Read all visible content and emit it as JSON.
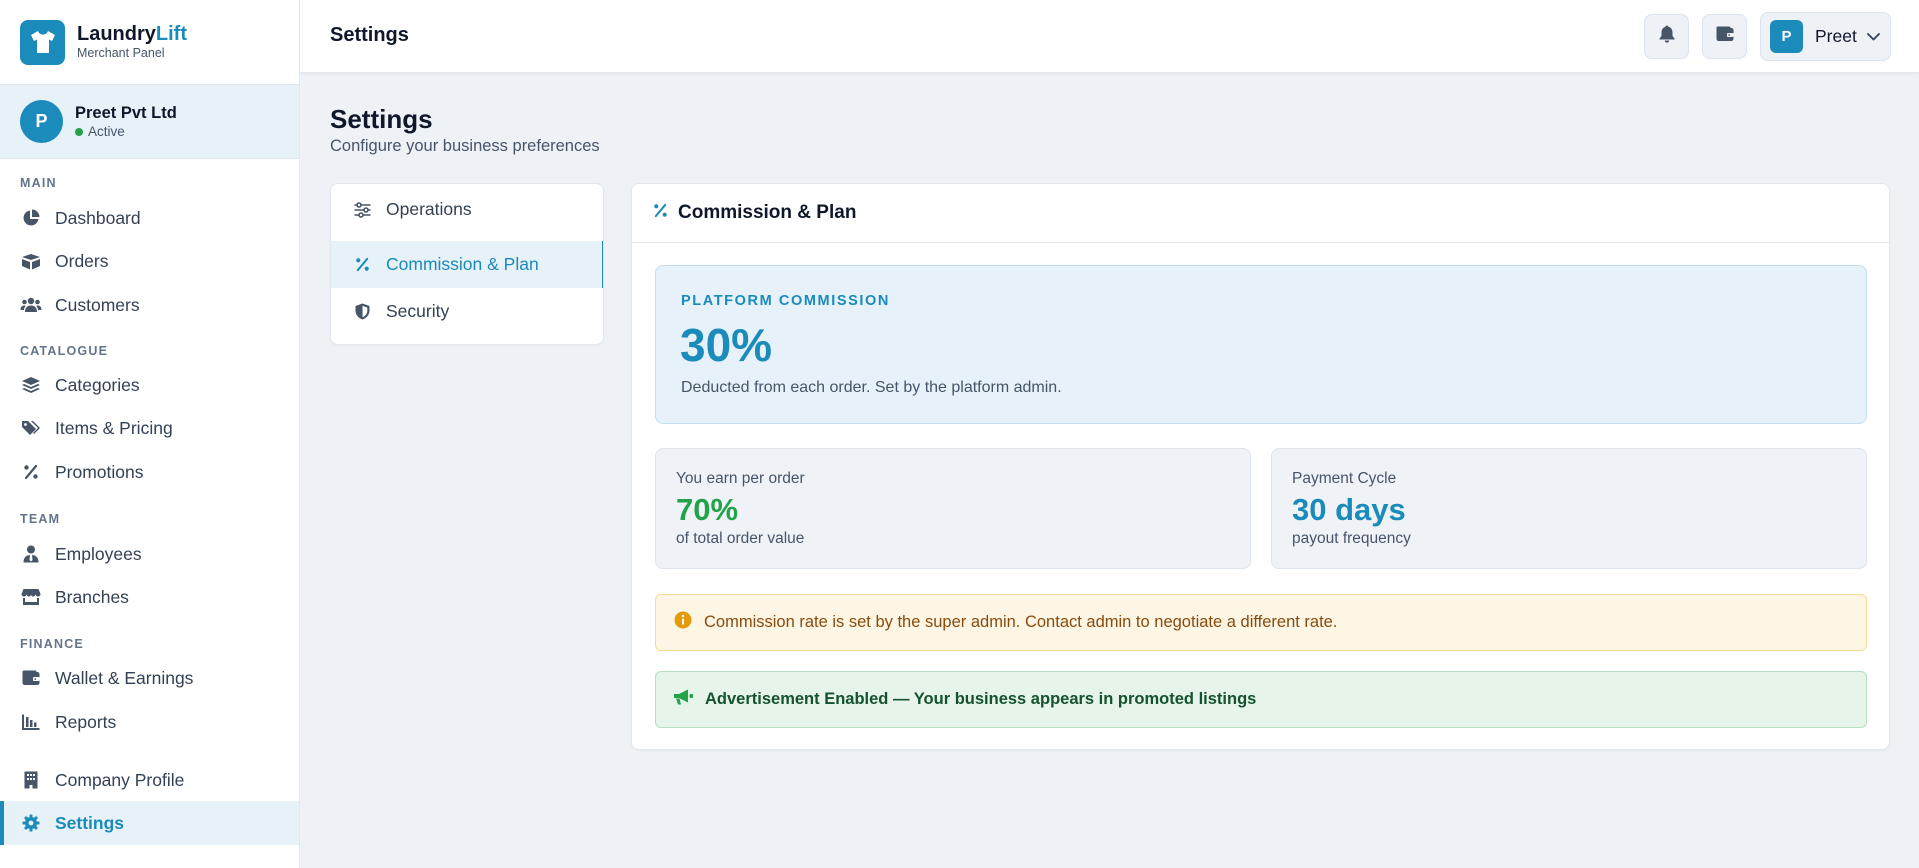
{
  "brand": {
    "name_part1": "Laundry",
    "name_part2": "Lift",
    "subtitle": "Merchant Panel"
  },
  "company": {
    "avatar_initial": "P",
    "name": "Preet Pvt Ltd",
    "status": "Active"
  },
  "sidebar": {
    "sections": {
      "main": "MAIN",
      "catalogue": "CATALOGUE",
      "team": "TEAM",
      "finance": "FINANCE"
    },
    "items": {
      "dashboard": "Dashboard",
      "orders": "Orders",
      "customers": "Customers",
      "categories": "Categories",
      "items_pricing": "Items & Pricing",
      "promotions": "Promotions",
      "employees": "Employees",
      "branches": "Branches",
      "wallet": "Wallet & Earnings",
      "reports": "Reports",
      "company_profile": "Company Profile",
      "settings": "Settings"
    },
    "active": "settings"
  },
  "topbar": {
    "title": "Settings",
    "user_initial": "P",
    "user_name": "Preet"
  },
  "page": {
    "title": "Settings",
    "subtitle": "Configure your business preferences"
  },
  "tabs": {
    "operations": "Operations",
    "commission": "Commission & Plan",
    "security": "Security",
    "active": "commission"
  },
  "panel": {
    "title": "Commission & Plan",
    "commission": {
      "label": "PLATFORM COMMISSION",
      "value": "30%",
      "note": "Deducted from each order. Set by the platform admin."
    },
    "earn": {
      "label": "You earn per order",
      "value": "70%",
      "sub": "of total order value",
      "color": "#22a34a"
    },
    "cycle": {
      "label": "Payment Cycle",
      "value": "30 days",
      "sub": "payout frequency",
      "color": "#1a8bba"
    },
    "info": "Commission rate is set by the super admin. Contact admin to negotiate a different rate.",
    "ad": "Advertisement Enabled — Your business appears in promoted listings"
  },
  "colors": {
    "accent": "#1a8bba",
    "success": "#22a34a",
    "warning": "#e39a0b"
  }
}
